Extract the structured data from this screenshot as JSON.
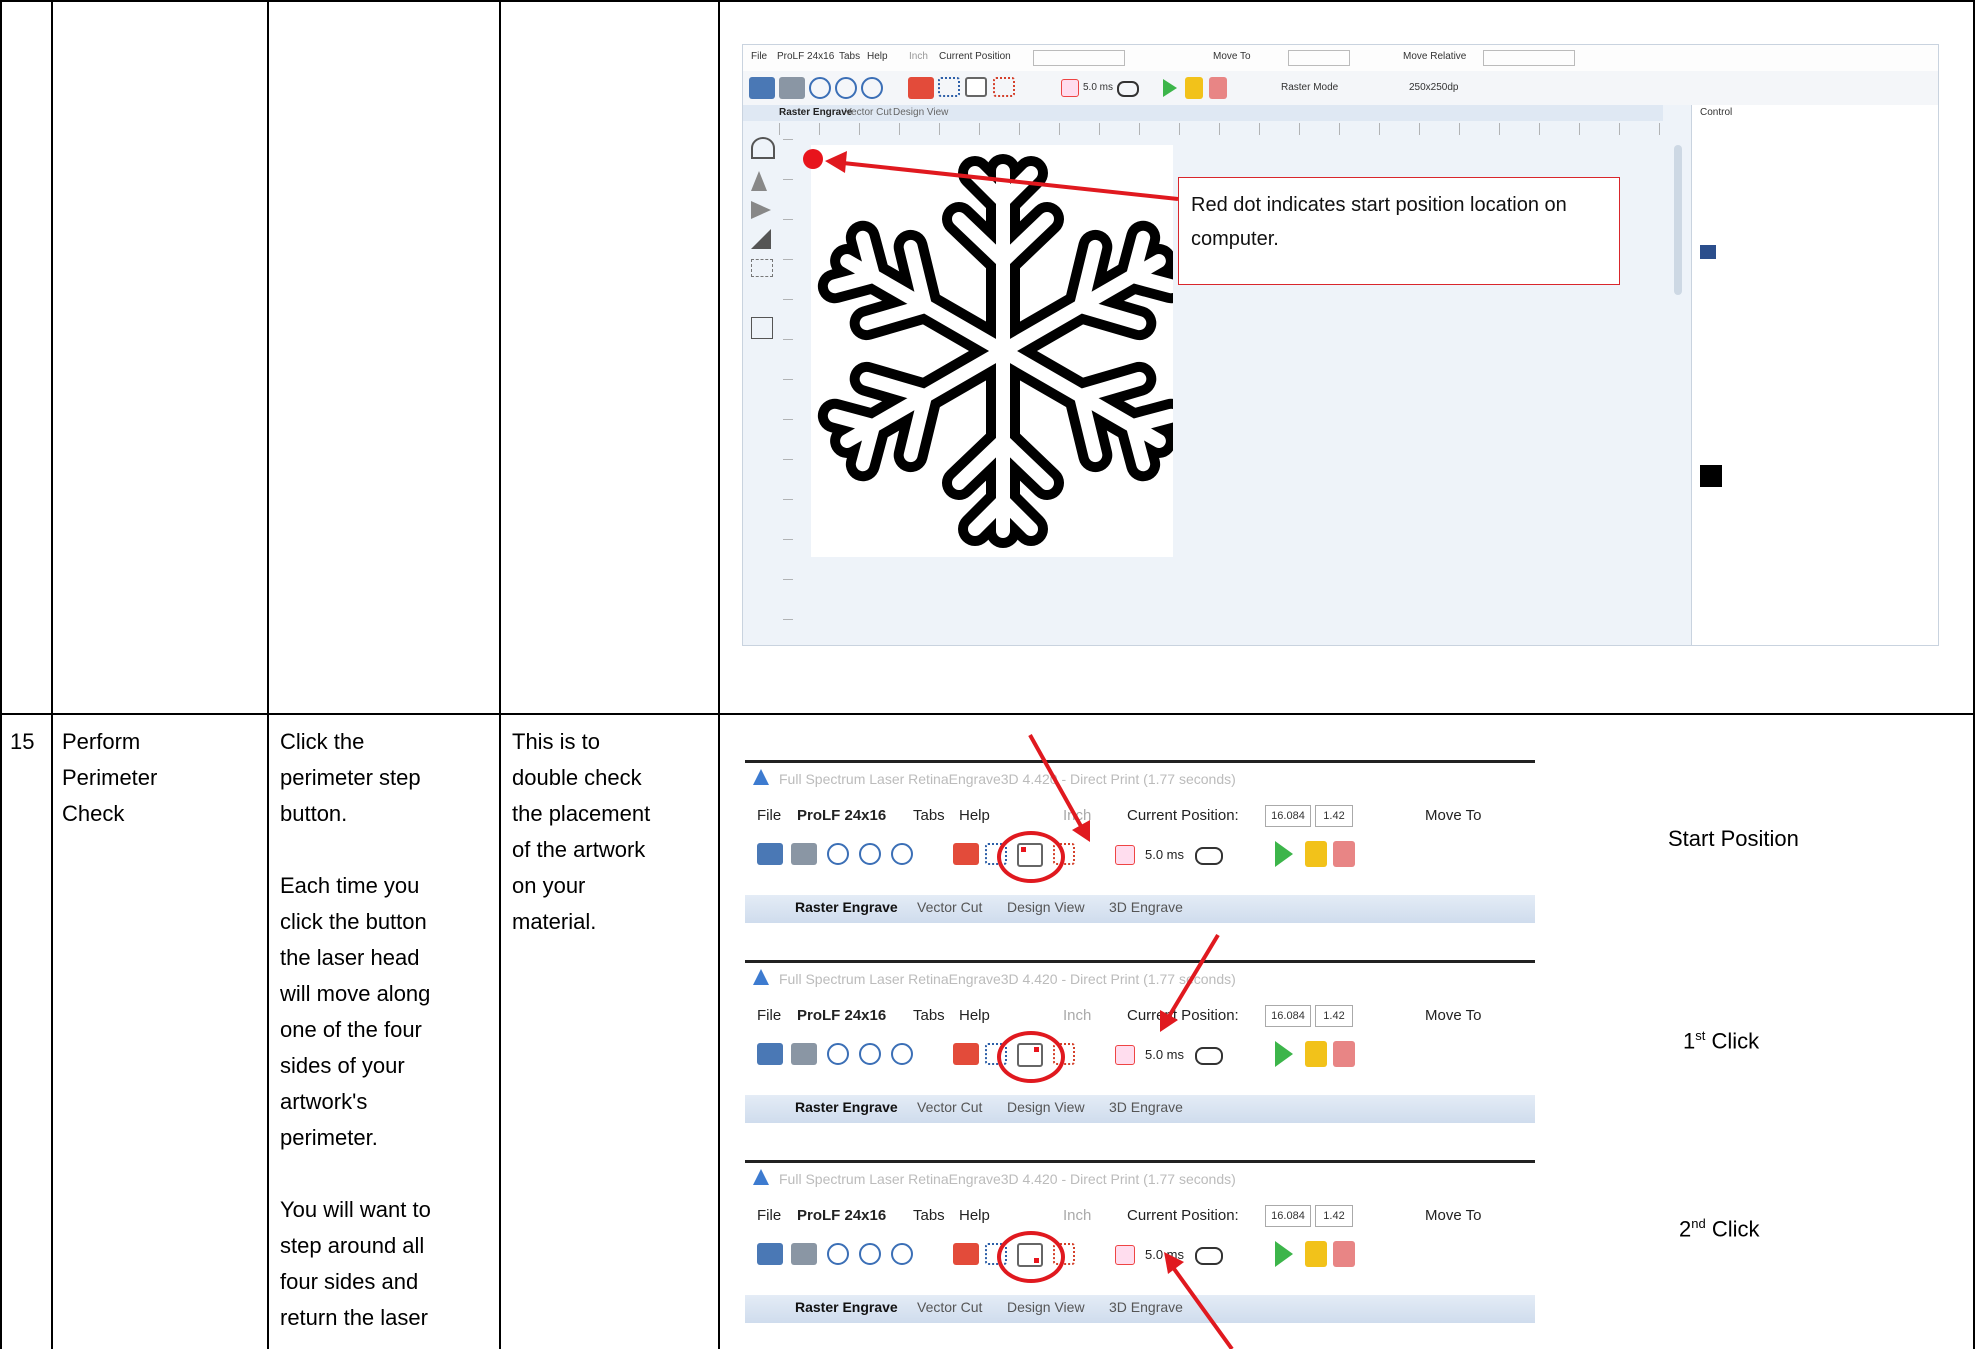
{
  "row_top": {
    "screenshot": {
      "menu": [
        "File",
        "ProLF 24x16",
        "Tabs",
        "Help"
      ],
      "unit": "Inch",
      "current_position_label": "Current Position",
      "move_to_label": "Move To",
      "move_relative_label": "Move Relative",
      "laser_time": "5.0 ms",
      "mode_select": "Raster Mode",
      "dpi_select": "250x250dp",
      "tabs": [
        "Raster Engrave",
        "Vector Cut",
        "Design View"
      ],
      "right_panel_label": "Control",
      "callout": "Red dot indicates start position location on computer."
    }
  },
  "row_step": {
    "number": "15",
    "title": "Perform\nPerimeter\nCheck",
    "instructions": "Click the\nperimeter step\nbutton.\n\nEach time you\nclick the button\nthe laser head\nwill move along\none of the four\nsides of your\nartwork's\nperimeter.\n\nYou will want to\nstep around all\nfour sides and\nreturn the laser",
    "purpose": "This is to\ndouble check\nthe placement\nof the artwork\non your\nmaterial.",
    "screenshots": [
      {
        "window_title": "Full Spectrum Laser RetinaEngrave3D 4.420 - Direct Print (1.77 seconds)",
        "menu": [
          "File",
          "ProLF 24x16",
          "Tabs",
          "Help"
        ],
        "unit": "Inch",
        "position_label": "Current Position:",
        "x": "16.084",
        "y": "1.42",
        "move_to": "Move To",
        "laser_time": "5.0 ms",
        "tabs": [
          "Raster Engrave",
          "Vector Cut",
          "Design View",
          "3D Engrave"
        ],
        "label": "Start Position",
        "sup": ""
      },
      {
        "window_title": "Full Spectrum Laser RetinaEngrave3D 4.420 - Direct Print (1.77 seconds)",
        "menu": [
          "File",
          "ProLF 24x16",
          "Tabs",
          "Help"
        ],
        "unit": "Inch",
        "position_label": "Current Position:",
        "x": "16.084",
        "y": "1.42",
        "move_to": "Move To",
        "laser_time": "5.0 ms",
        "tabs": [
          "Raster Engrave",
          "Vector Cut",
          "Design View",
          "3D Engrave"
        ],
        "label": "1",
        "sup": "st",
        "label_suffix": " Click"
      },
      {
        "window_title": "Full Spectrum Laser RetinaEngrave3D 4.420 - Direct Print (1.77 seconds)",
        "menu": [
          "File",
          "ProLF 24x16",
          "Tabs",
          "Help"
        ],
        "unit": "Inch",
        "position_label": "Current Position:",
        "x": "16.084",
        "y": "1.42",
        "move_to": "Move To",
        "laser_time": "5.0 ms",
        "tabs": [
          "Raster Engrave",
          "Vector Cut",
          "Design View",
          "3D Engrave"
        ],
        "label": "2",
        "sup": "nd",
        "label_suffix": " Click"
      }
    ]
  }
}
